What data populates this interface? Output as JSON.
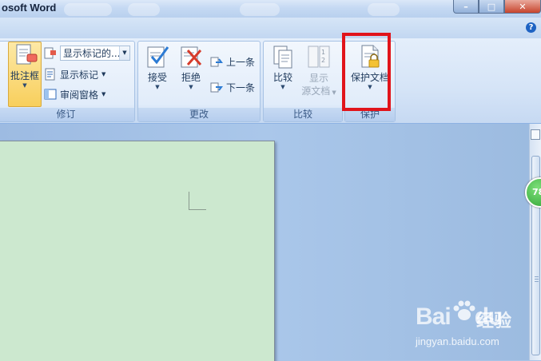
{
  "window": {
    "title": "osoft Word",
    "controls": {
      "minimize": "–",
      "restore": "□",
      "close": "✕"
    },
    "help": "?"
  },
  "ribbon": {
    "groups": {
      "tracking": {
        "label": "修订",
        "balloons_label": "批注框",
        "show_markup_combo": "显示标记的...",
        "show_markup_label": "显示标记",
        "reviewing_pane_label": "审阅窗格"
      },
      "changes": {
        "label": "更改",
        "accept_label": "接受",
        "reject_label": "拒绝",
        "previous_label": "上一条",
        "next_label": "下一条"
      },
      "compare": {
        "label": "比较",
        "compare_label": "比较",
        "show_source_line1": "显示",
        "show_source_line2": "源文档"
      },
      "protect": {
        "label": "保护",
        "protect_document_label": "保护文档"
      }
    }
  },
  "scroll": {
    "badge": "78"
  },
  "watermark": {
    "brand": "Bai",
    "brand2": "du",
    "cn": "经验",
    "url": "jingyan.baidu.com"
  },
  "colors": {
    "highlight": "#e1141b",
    "page": "#cce8cf",
    "ribbon": "#dce9f8"
  }
}
